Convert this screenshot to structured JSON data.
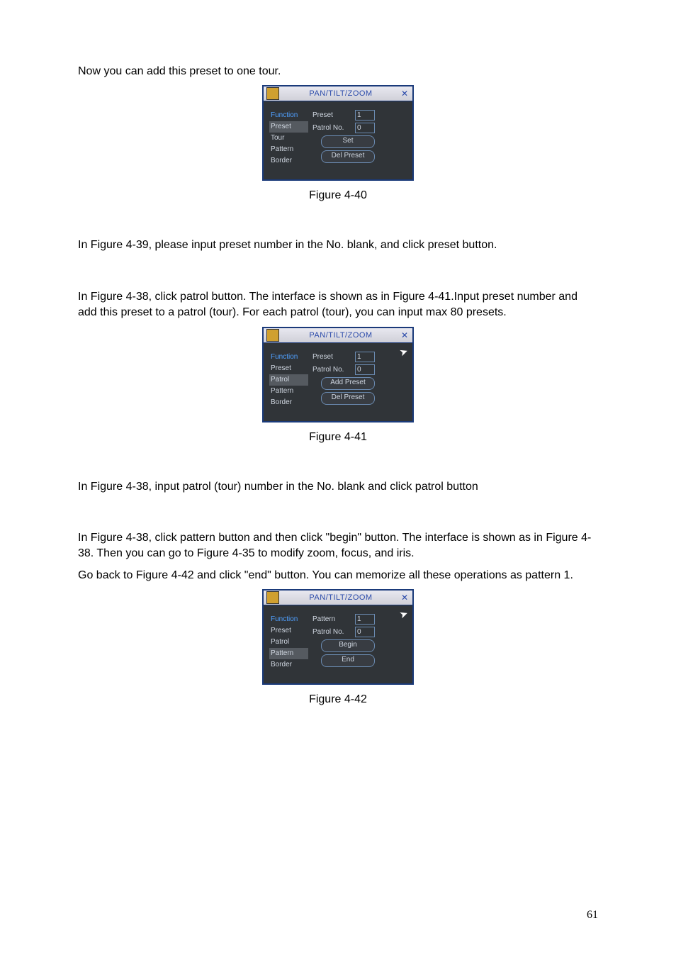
{
  "paragraphs": {
    "p1": "Now you can add this preset to one tour.",
    "p2": "In Figure 4-39, please input preset number in the No. blank, and click preset button.",
    "p3": "In  Figure 4-38, click patrol button. The interface is shown as in  Figure 4-41.Input preset number and add this preset to a patrol (tour). For each patrol (tour), you can input max 80 presets.",
    "p4": "In  Figure 4-38, input patrol (tour) number in the No. blank and click patrol button",
    "p5a": "In  Figure 4-38, click pattern button and then click \"begin\" button. The interface is shown as in  Figure 4-38. Then you can go to Figure 4-35  to modify zoom, focus, and iris.",
    "p5b": "Go back to  Figure 4-42 and click \"end\" button. You can memorize all these operations as pattern 1."
  },
  "captions": {
    "c1": "Figure 4-40",
    "c2": "Figure 4-41",
    "c3": "Figure 4-42"
  },
  "ptz": {
    "title": "PAN/TILT/ZOOM",
    "close_glyph": "✕",
    "menu": {
      "function": "Function",
      "preset": "Preset",
      "tour": "Tour",
      "patrol": "Patrol",
      "pattern": "Pattern",
      "border": "Border"
    },
    "labels": {
      "preset": "Preset",
      "pattern": "Pattern",
      "patrol_no": "Patrol No."
    },
    "values": {
      "one": "1",
      "zero": "0"
    },
    "buttons": {
      "set": "Set",
      "del_preset": "Del Preset",
      "add_preset": "Add Preset",
      "begin": "Begin",
      "end": "End"
    }
  },
  "cursor_glyph": "➤",
  "page_number": "61"
}
